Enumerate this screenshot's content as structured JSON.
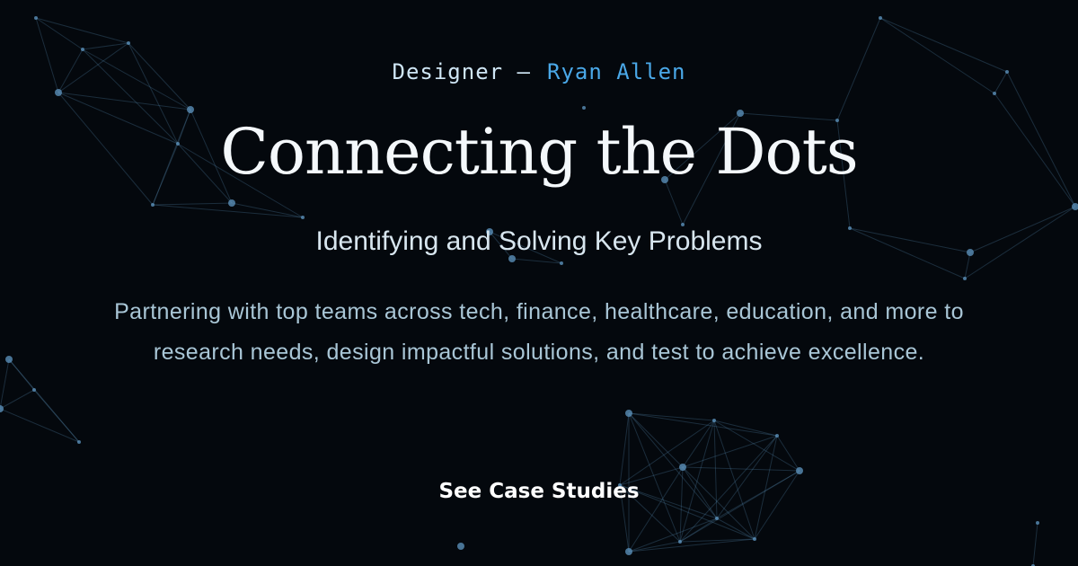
{
  "hero": {
    "role": "Designer —",
    "name": "Ryan Allen",
    "title": "Connecting the Dots",
    "subtitle": "Identifying and Solving Key Problems",
    "description": "Partnering with top teams across tech, finance, healthcare, education, and more to research needs, design impactful solutions, and test to achieve excellence.",
    "cta_label": "See Case Studies"
  },
  "colors": {
    "background": "#04080d",
    "accent": "#4aa8e8",
    "network": "#5a8fb8"
  },
  "background_icon": "network-constellation"
}
